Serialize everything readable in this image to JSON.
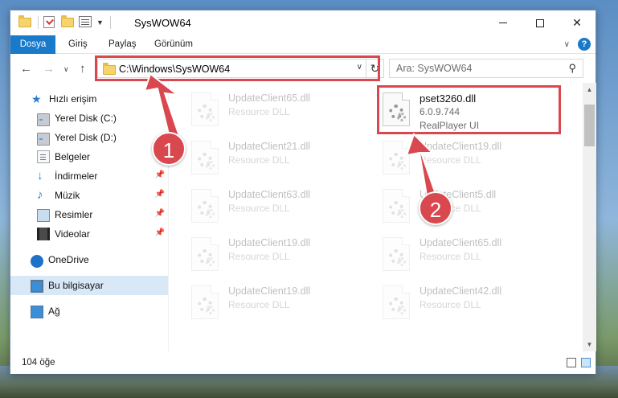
{
  "window": {
    "title": "SysWOW64",
    "controls": {
      "minimize_icon": "minimize-icon",
      "maximize_icon": "maximize-icon",
      "close_icon": "close-icon",
      "close_glyph": "✕"
    }
  },
  "ribbon": {
    "tabs": [
      {
        "label": "Dosya"
      },
      {
        "label": "Giriş"
      },
      {
        "label": "Paylaş"
      },
      {
        "label": "Görünüm"
      }
    ]
  },
  "address_bar": {
    "path": "C:\\Windows\\SysWOW64",
    "search_placeholder": "Ara: SysWOW64"
  },
  "sidebar": {
    "items": [
      {
        "label": "Hızlı erişim",
        "icon": "star-icon"
      },
      {
        "label": "Yerel Disk (C:)",
        "icon": "drive-icon"
      },
      {
        "label": "Yerel Disk (D:)",
        "icon": "drive-icon"
      },
      {
        "label": "Belgeler",
        "icon": "documents-icon",
        "pinned": true
      },
      {
        "label": "İndirmeler",
        "icon": "downloads-icon",
        "pinned": true
      },
      {
        "label": "Müzik",
        "icon": "music-icon",
        "pinned": true
      },
      {
        "label": "Resimler",
        "icon": "pictures-icon",
        "pinned": true
      },
      {
        "label": "Videolar",
        "icon": "videos-icon",
        "pinned": true
      },
      {
        "label": "OneDrive",
        "icon": "cloud-icon"
      },
      {
        "label": "Bu bilgisayar",
        "icon": "computer-icon",
        "selected": true
      },
      {
        "label": "Ağ",
        "icon": "network-icon"
      }
    ]
  },
  "files": [
    {
      "name": "UpdateClient65.dll",
      "type": "Resource DLL"
    },
    {
      "name": "pset3260.dll",
      "type": "6.0.9.744",
      "description": "RealPlayer UI",
      "highlighted": true
    },
    {
      "name": "UpdateClient21.dll",
      "type": "Resource DLL"
    },
    {
      "name": "UpdateClient19.dll",
      "type": "Resource DLL"
    },
    {
      "name": "UpdateClient63.dll",
      "type": "Resource DLL"
    },
    {
      "name": "UpdateClient5.dll",
      "type": "Resource DLL"
    },
    {
      "name": "UpdateClient19.dll",
      "type": "Resource DLL"
    },
    {
      "name": "UpdateClient65.dll",
      "type": "Resource DLL"
    },
    {
      "name": "UpdateClient19.dll",
      "type": "Resource DLL"
    },
    {
      "name": "UpdateClient42.dll",
      "type": "Resource DLL"
    }
  ],
  "status_bar": {
    "item_count": "104 öğe"
  },
  "annotations": [
    {
      "number": "1"
    },
    {
      "number": "2"
    }
  ],
  "colors": {
    "accent": "#1979ca",
    "highlight_box": "#d9474f",
    "selected_bg": "#d9e8f7"
  }
}
